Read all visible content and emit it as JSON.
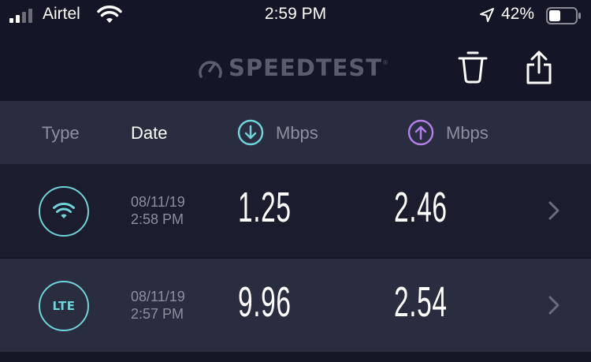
{
  "status_bar": {
    "carrier": "Airtel",
    "time": "2:59 PM",
    "battery_percent": "42%",
    "icons": [
      "signal-icon",
      "wifi-icon",
      "location-arrow-icon",
      "battery-icon"
    ]
  },
  "nav": {
    "logo_text": "SPEEDTEST",
    "logo_tm": "®",
    "actions": [
      "trash-icon",
      "share-icon"
    ]
  },
  "columns": {
    "type": "Type",
    "date": "Date",
    "download": "Mbps",
    "upload": "Mbps"
  },
  "rows": [
    {
      "type": "wifi",
      "type_label": "",
      "date": "08/11/19",
      "time": "2:58 PM",
      "download": "1.25",
      "upload": "2.46"
    },
    {
      "type": "lte",
      "type_label": "LTE",
      "date": "08/11/19",
      "time": "2:57 PM",
      "download": "9.96",
      "upload": "2.54"
    }
  ],
  "colors": {
    "background": "#151626",
    "header_row": "#2a2c40",
    "accent_download": "#6fd3d8",
    "accent_upload": "#b07fe8",
    "muted_text": "#8d8fa0"
  }
}
